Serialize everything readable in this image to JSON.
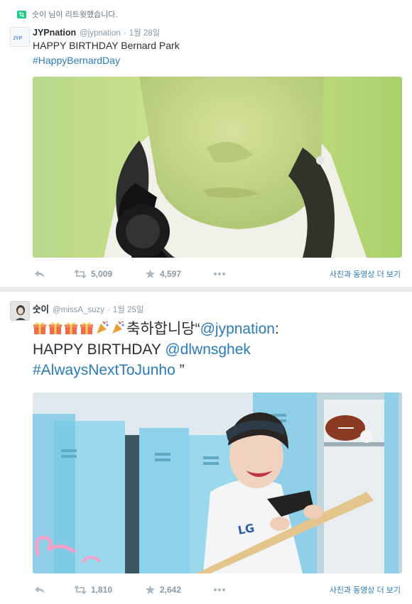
{
  "tweet1": {
    "retweet_context": "숫이 님이 리트윗했습니다.",
    "author_name": "JYPnation",
    "author_handle": "@jypnation",
    "separator": "·",
    "timestamp": "1월 28일",
    "text": "HAPPY BIRTHDAY Bernard Park",
    "hashtag": "#HappyBernardDay",
    "actions": {
      "retweet_count": "5,009",
      "favorite_count": "4,597",
      "view_media_label": "사진과 동영상 더 보기"
    },
    "avatar_text": "JYP"
  },
  "tweet2": {
    "author_name": "숫이",
    "author_handle": "@missA_suzy",
    "separator": "·",
    "timestamp": "1월 25일",
    "text_prefix": "축하합니당“",
    "mention1": "@jypnation",
    "colon": ":",
    "line2_prefix": "HAPPY BIRTHDAY ",
    "mention2": "@dlwnsghek",
    "hashtag": "#AlwaysNextToJunho",
    "closing": " ”",
    "actions": {
      "retweet_count": "1,810",
      "favorite_count": "2,642",
      "view_media_label": "사진과 동영상 더 보기"
    }
  },
  "colors": {
    "link": "#2b7bb9",
    "muted": "#8899a6",
    "retweet_green": "#19cf86"
  },
  "icons": [
    "retweet-icon",
    "reply-icon",
    "star-icon",
    "more-icon",
    "gift-emoji",
    "party-popper-emoji"
  ]
}
